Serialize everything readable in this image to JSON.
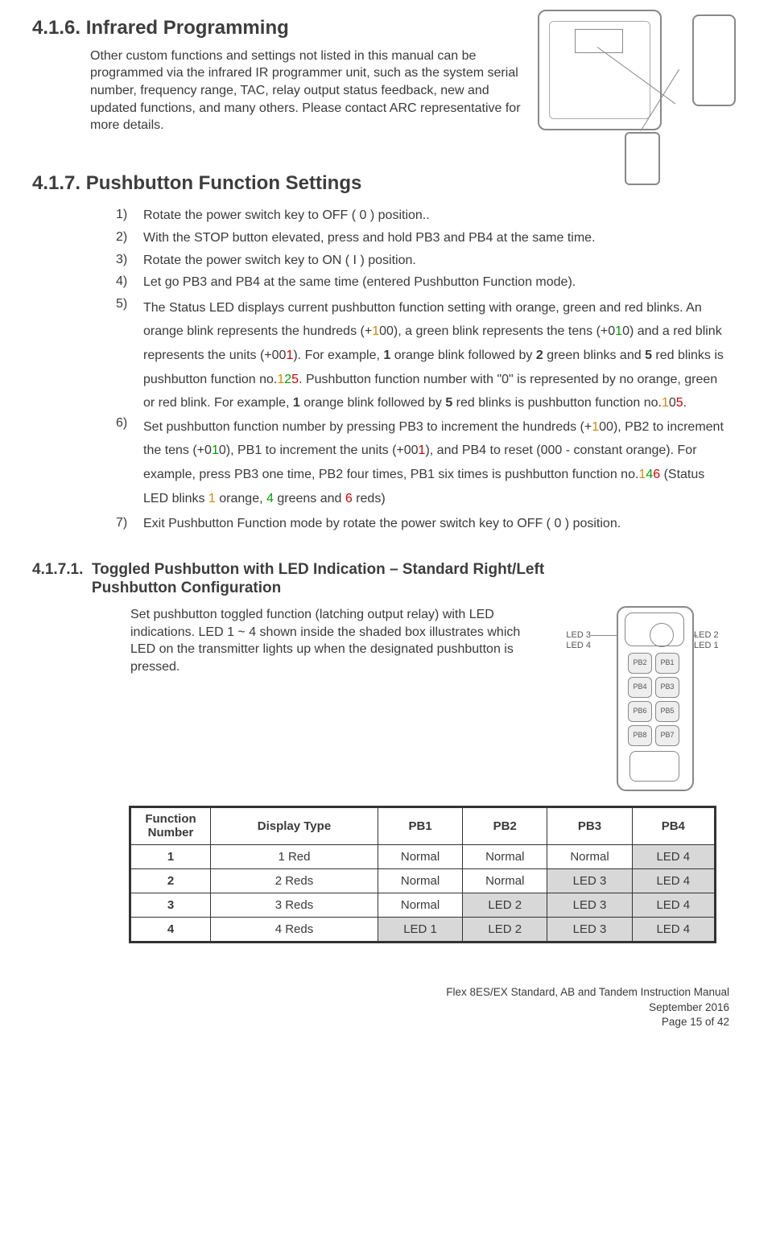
{
  "s416": {
    "heading": "4.1.6. Infrared Programming",
    "para": "Other custom functions and settings not listed in this manual can be programmed via the infrared IR programmer unit, such as the system serial number, frequency range, TAC, relay output status feedback, new and updated functions, and many others.  Please contact ARC representative for more details."
  },
  "s417": {
    "heading": "4.1.7. Pushbutton Function Settings",
    "steps": {
      "n1": "1)",
      "t1": "Rotate the power switch key to OFF ( 0 ) position..",
      "n2": "2)",
      "t2": "With the STOP button elevated, press and hold PB3 and PB4 at the same time.",
      "n3": "3)",
      "t3": "Rotate the power switch key to ON ( I ) position.",
      "n4": "4)",
      "t4": "Let go PB3 and PB4 at the same time (entered Pushbutton Function mode).",
      "n5": "5)",
      "n6": "6)",
      "n7": "7)",
      "t7": "Exit Pushbutton Function mode by rotate the power switch key to OFF ( 0 ) position."
    }
  },
  "s4171": {
    "heading": "4.1.7.1.  Toggled Pushbutton with LED Indication – Standard Right/Left Pushbutton Configuration",
    "para": "Set pushbutton toggled function (latching output relay) with LED indications.  LED 1 ~ 4 shown inside the shaded box illustrates which LED on the transmitter lights up when the designated pushbutton is pressed.",
    "led_l1": "LED 3",
    "led_l2": "LED 4",
    "led_r1": "LED 2",
    "led_r2": "LED 1",
    "pb": {
      "p1": "PB1",
      "p2": "PB2",
      "p3": "PB3",
      "p4": "PB4",
      "p5": "PB5",
      "p6": "PB6",
      "p7": "PB7",
      "p8": "PB8"
    }
  },
  "table": {
    "h_fn": "Function Number",
    "h_dt": "Display Type",
    "h_pb1": "PB1",
    "h_pb2": "PB2",
    "h_pb3": "PB3",
    "h_pb4": "PB4",
    "rows": [
      {
        "fn": "1",
        "dt": "1 Red",
        "pb1": "Normal",
        "pb2": "Normal",
        "pb3": "Normal",
        "pb4": "LED 4",
        "sh": [
          0,
          0,
          0,
          1
        ]
      },
      {
        "fn": "2",
        "dt": "2 Reds",
        "pb1": "Normal",
        "pb2": "Normal",
        "pb3": "LED 3",
        "pb4": "LED 4",
        "sh": [
          0,
          0,
          1,
          1
        ]
      },
      {
        "fn": "3",
        "dt": "3 Reds",
        "pb1": "Normal",
        "pb2": "LED 2",
        "pb3": "LED 3",
        "pb4": "LED 4",
        "sh": [
          0,
          1,
          1,
          1
        ]
      },
      {
        "fn": "4",
        "dt": "4 Reds",
        "pb1": "LED 1",
        "pb2": "LED 2",
        "pb3": "LED 3",
        "pb4": "LED 4",
        "sh": [
          1,
          1,
          1,
          1
        ]
      }
    ]
  },
  "footer": {
    "l1": "Flex 8ES/EX Standard, AB and Tandem Instruction Manual",
    "l2": "September 2016",
    "l3": "Page 15 of 42"
  }
}
